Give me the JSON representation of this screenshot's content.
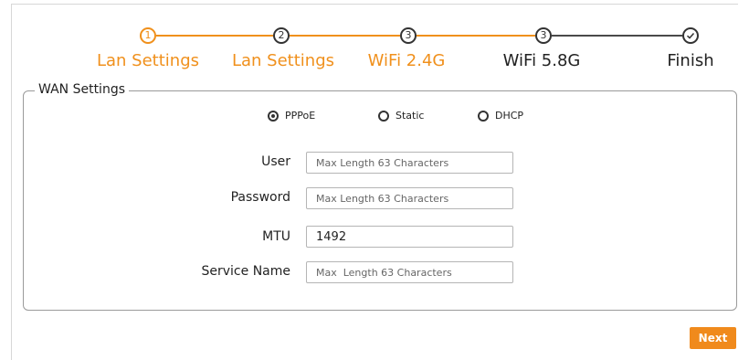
{
  "stepper": {
    "steps": [
      {
        "number": "1",
        "label": "Lan Settings",
        "state": "active"
      },
      {
        "number": "2",
        "label": "Lan Settings",
        "state": "active"
      },
      {
        "number": "3",
        "label": "WiFi 2.4G",
        "state": "active"
      },
      {
        "number": "3",
        "label": "WiFi 5.8G",
        "state": "pending"
      },
      {
        "number": "",
        "label": "Finish",
        "state": "pending",
        "icon": "check-icon"
      }
    ],
    "colors": {
      "active": "#f0901c",
      "pending": "#333333"
    }
  },
  "wan": {
    "legend": "WAN Settings",
    "connection_types": [
      {
        "label": "PPPoE",
        "checked": true
      },
      {
        "label": "Static",
        "checked": false
      },
      {
        "label": "DHCP",
        "checked": false
      }
    ],
    "fields": {
      "user": {
        "label": "User",
        "value": "",
        "placeholder": "Max Length 63 Characters"
      },
      "password": {
        "label": "Password",
        "value": "",
        "placeholder": "Max Length 63 Characters"
      },
      "mtu": {
        "label": "MTU",
        "value": "1492",
        "placeholder": ""
      },
      "service_name": {
        "label": "Service Name",
        "value": "",
        "placeholder": "Max  Length 63 Characters"
      }
    }
  },
  "actions": {
    "next_label": "Next",
    "accent": "#f08a1c"
  }
}
